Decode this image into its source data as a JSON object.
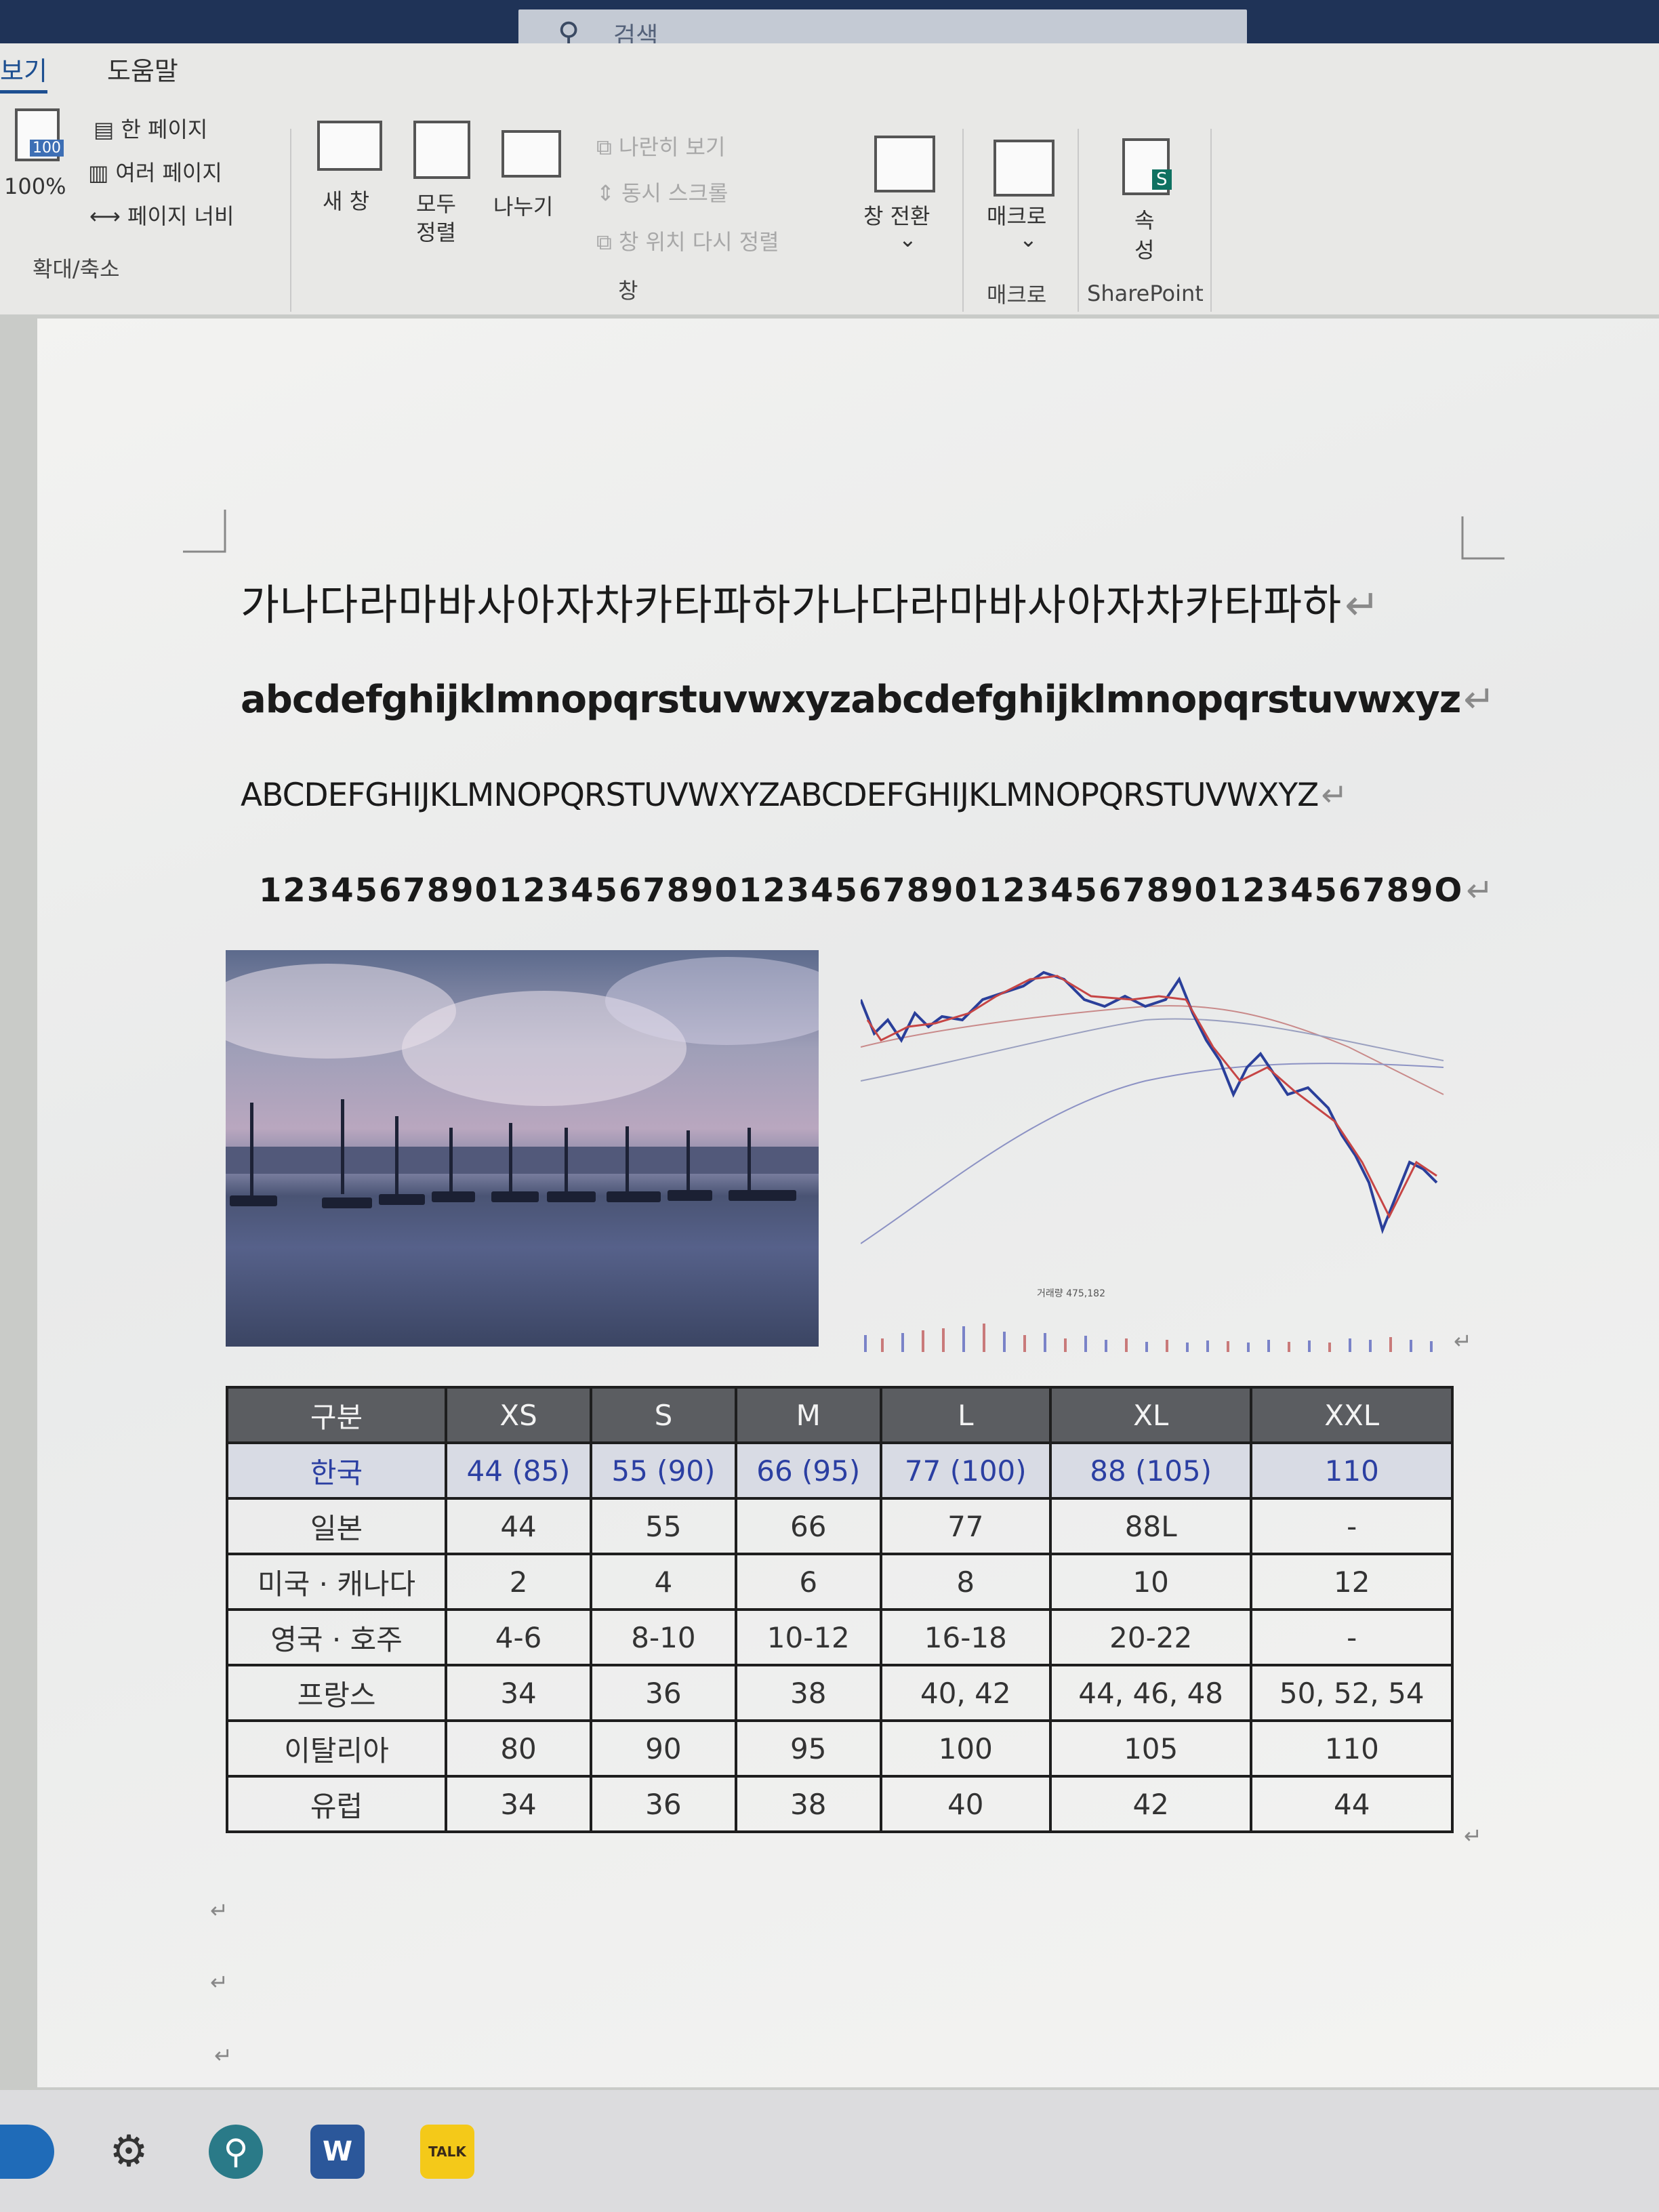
{
  "titlebar": {
    "search_placeholder": "검색"
  },
  "ribbon": {
    "tabs": [
      "보기",
      "도움말"
    ],
    "zoom": {
      "percent_label": "100%",
      "icon_label": "100",
      "one_page": "한 페이지",
      "multi_page": "여러 페이지",
      "page_width": "페이지 너비",
      "group": "확대/축소"
    },
    "window": {
      "new_window": "새 창",
      "arrange_all_1": "모두",
      "arrange_all_2": "정렬",
      "split": "나누기",
      "side_by_side": "나란히 보기",
      "sync_scroll": "동시 스크롤",
      "reset_position": "창 위치 다시 정렬",
      "group": "창"
    },
    "switch_window": {
      "label": "창 전환",
      "arrow": "⌄"
    },
    "macro": {
      "label": "매크로",
      "arrow": "⌄",
      "group": "매크로"
    },
    "sharepoint": {
      "label_1": "속",
      "label_2": "성",
      "group": "SharePoint",
      "badge": "S"
    }
  },
  "document": {
    "lines": [
      "가나다라마바사아자차카타파하가나다라마바사아자차카타파하",
      "abcdefghijklmnopqrstuvwxyzabcdefghijklmnopqrstuvwxyz",
      "ABCDEFGHIJKLMNOPQRSTUVWXYZABCDEFGHIJKLMNOPQRSTUVWXYZ",
      "1234567890123456789012345678901234567890123456789O"
    ],
    "paragraph_mark": "↵",
    "stock_volume_label": "거래량 475,182",
    "size_table": {
      "headers": [
        "구분",
        "XS",
        "S",
        "M",
        "L",
        "XL",
        "XXL"
      ],
      "rows": [
        [
          "한국",
          "44 (85)",
          "55 (90)",
          "66 (95)",
          "77 (100)",
          "88 (105)",
          "110"
        ],
        [
          "일본",
          "44",
          "55",
          "66",
          "77",
          "88L",
          "-"
        ],
        [
          "미국 · 캐나다",
          "2",
          "4",
          "6",
          "8",
          "10",
          "12"
        ],
        [
          "영국 · 호주",
          "4-6",
          "8-10",
          "10-12",
          "16-18",
          "20-22",
          "-"
        ],
        [
          "프랑스",
          "34",
          "36",
          "38",
          "40, 42",
          "44, 46, 48",
          "50, 52, 54"
        ],
        [
          "이탈리아",
          "80",
          "90",
          "95",
          "100",
          "105",
          "110"
        ],
        [
          "유럽",
          "34",
          "36",
          "38",
          "40",
          "42",
          "44"
        ]
      ]
    }
  },
  "taskbar": {
    "icons": [
      "mail-icon",
      "settings-icon",
      "search-app-icon",
      "word-icon",
      "kakaotalk-icon"
    ],
    "talk_label": "TALK",
    "word_label": "W"
  }
}
